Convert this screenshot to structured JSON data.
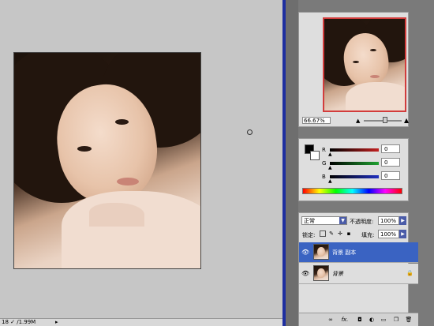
{
  "status": {
    "zoom_readout": "18 ✓ /1.99M"
  },
  "navigator": {
    "zoom_value": "66.67%"
  },
  "color": {
    "channels": [
      {
        "label": "R",
        "value": "0",
        "color": "#c22020"
      },
      {
        "label": "G",
        "value": "0",
        "color": "#1ea030"
      },
      {
        "label": "B",
        "value": "0",
        "color": "#2030c0"
      }
    ],
    "foreground": "#000000",
    "background": "#ffffff"
  },
  "layers": {
    "blend_mode": "正常",
    "opacity_label": "不透明度:",
    "opacity_value": "100%",
    "lock_label": "锁定:",
    "fill_label": "填充:",
    "fill_value": "100%",
    "items": [
      {
        "name": "背景 副本",
        "selected": true
      },
      {
        "name": "背景",
        "selected": false
      }
    ],
    "footer_fx": "fx."
  },
  "accent": "#3a63c2"
}
